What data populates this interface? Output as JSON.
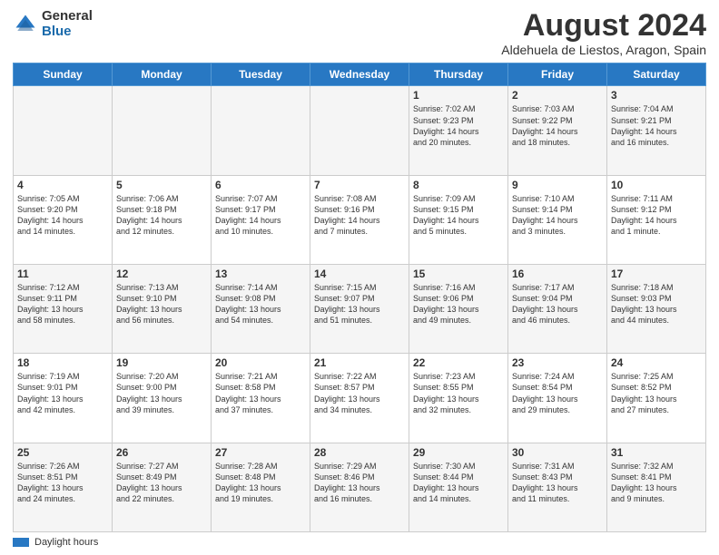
{
  "logo": {
    "general": "General",
    "blue": "Blue"
  },
  "title": "August 2024",
  "subtitle": "Aldehuela de Liestos, Aragon, Spain",
  "days_header": [
    "Sunday",
    "Monday",
    "Tuesday",
    "Wednesday",
    "Thursday",
    "Friday",
    "Saturday"
  ],
  "weeks": [
    [
      {
        "num": "",
        "info": ""
      },
      {
        "num": "",
        "info": ""
      },
      {
        "num": "",
        "info": ""
      },
      {
        "num": "",
        "info": ""
      },
      {
        "num": "1",
        "info": "Sunrise: 7:02 AM\nSunset: 9:23 PM\nDaylight: 14 hours\nand 20 minutes."
      },
      {
        "num": "2",
        "info": "Sunrise: 7:03 AM\nSunset: 9:22 PM\nDaylight: 14 hours\nand 18 minutes."
      },
      {
        "num": "3",
        "info": "Sunrise: 7:04 AM\nSunset: 9:21 PM\nDaylight: 14 hours\nand 16 minutes."
      }
    ],
    [
      {
        "num": "4",
        "info": "Sunrise: 7:05 AM\nSunset: 9:20 PM\nDaylight: 14 hours\nand 14 minutes."
      },
      {
        "num": "5",
        "info": "Sunrise: 7:06 AM\nSunset: 9:18 PM\nDaylight: 14 hours\nand 12 minutes."
      },
      {
        "num": "6",
        "info": "Sunrise: 7:07 AM\nSunset: 9:17 PM\nDaylight: 14 hours\nand 10 minutes."
      },
      {
        "num": "7",
        "info": "Sunrise: 7:08 AM\nSunset: 9:16 PM\nDaylight: 14 hours\nand 7 minutes."
      },
      {
        "num": "8",
        "info": "Sunrise: 7:09 AM\nSunset: 9:15 PM\nDaylight: 14 hours\nand 5 minutes."
      },
      {
        "num": "9",
        "info": "Sunrise: 7:10 AM\nSunset: 9:14 PM\nDaylight: 14 hours\nand 3 minutes."
      },
      {
        "num": "10",
        "info": "Sunrise: 7:11 AM\nSunset: 9:12 PM\nDaylight: 14 hours\nand 1 minute."
      }
    ],
    [
      {
        "num": "11",
        "info": "Sunrise: 7:12 AM\nSunset: 9:11 PM\nDaylight: 13 hours\nand 58 minutes."
      },
      {
        "num": "12",
        "info": "Sunrise: 7:13 AM\nSunset: 9:10 PM\nDaylight: 13 hours\nand 56 minutes."
      },
      {
        "num": "13",
        "info": "Sunrise: 7:14 AM\nSunset: 9:08 PM\nDaylight: 13 hours\nand 54 minutes."
      },
      {
        "num": "14",
        "info": "Sunrise: 7:15 AM\nSunset: 9:07 PM\nDaylight: 13 hours\nand 51 minutes."
      },
      {
        "num": "15",
        "info": "Sunrise: 7:16 AM\nSunset: 9:06 PM\nDaylight: 13 hours\nand 49 minutes."
      },
      {
        "num": "16",
        "info": "Sunrise: 7:17 AM\nSunset: 9:04 PM\nDaylight: 13 hours\nand 46 minutes."
      },
      {
        "num": "17",
        "info": "Sunrise: 7:18 AM\nSunset: 9:03 PM\nDaylight: 13 hours\nand 44 minutes."
      }
    ],
    [
      {
        "num": "18",
        "info": "Sunrise: 7:19 AM\nSunset: 9:01 PM\nDaylight: 13 hours\nand 42 minutes."
      },
      {
        "num": "19",
        "info": "Sunrise: 7:20 AM\nSunset: 9:00 PM\nDaylight: 13 hours\nand 39 minutes."
      },
      {
        "num": "20",
        "info": "Sunrise: 7:21 AM\nSunset: 8:58 PM\nDaylight: 13 hours\nand 37 minutes."
      },
      {
        "num": "21",
        "info": "Sunrise: 7:22 AM\nSunset: 8:57 PM\nDaylight: 13 hours\nand 34 minutes."
      },
      {
        "num": "22",
        "info": "Sunrise: 7:23 AM\nSunset: 8:55 PM\nDaylight: 13 hours\nand 32 minutes."
      },
      {
        "num": "23",
        "info": "Sunrise: 7:24 AM\nSunset: 8:54 PM\nDaylight: 13 hours\nand 29 minutes."
      },
      {
        "num": "24",
        "info": "Sunrise: 7:25 AM\nSunset: 8:52 PM\nDaylight: 13 hours\nand 27 minutes."
      }
    ],
    [
      {
        "num": "25",
        "info": "Sunrise: 7:26 AM\nSunset: 8:51 PM\nDaylight: 13 hours\nand 24 minutes."
      },
      {
        "num": "26",
        "info": "Sunrise: 7:27 AM\nSunset: 8:49 PM\nDaylight: 13 hours\nand 22 minutes."
      },
      {
        "num": "27",
        "info": "Sunrise: 7:28 AM\nSunset: 8:48 PM\nDaylight: 13 hours\nand 19 minutes."
      },
      {
        "num": "28",
        "info": "Sunrise: 7:29 AM\nSunset: 8:46 PM\nDaylight: 13 hours\nand 16 minutes."
      },
      {
        "num": "29",
        "info": "Sunrise: 7:30 AM\nSunset: 8:44 PM\nDaylight: 13 hours\nand 14 minutes."
      },
      {
        "num": "30",
        "info": "Sunrise: 7:31 AM\nSunset: 8:43 PM\nDaylight: 13 hours\nand 11 minutes."
      },
      {
        "num": "31",
        "info": "Sunrise: 7:32 AM\nSunset: 8:41 PM\nDaylight: 13 hours\nand 9 minutes."
      }
    ]
  ],
  "footer": {
    "legend_label": "Daylight hours"
  }
}
